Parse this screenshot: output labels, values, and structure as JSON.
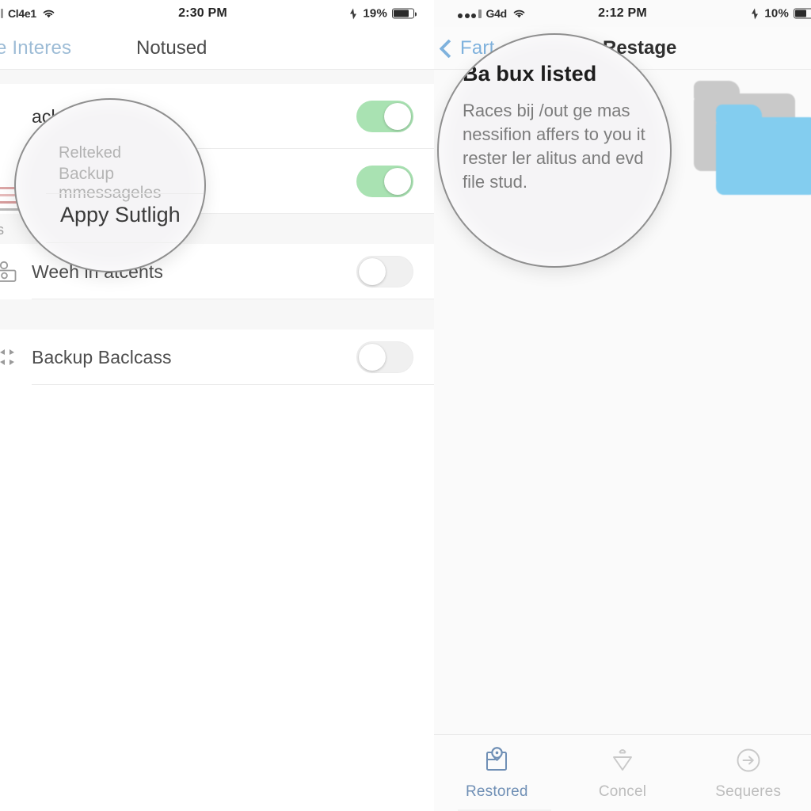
{
  "left_panel": {
    "status_bar": {
      "carrier": "Cl4e1",
      "wifi_icon": "wifi-icon",
      "time": "2:30 PM",
      "location_icon": "location-arrow-icon",
      "battery_percent": "19%",
      "battery_icon": "battery-icon"
    },
    "nav": {
      "back_label": "e Interes",
      "back_icon": "chevron-left-icon",
      "title": "Notused"
    },
    "rows": [
      {
        "icon": "backup-icon",
        "label": "ackus",
        "toggle_state": "on",
        "toggle_color": "#a9e2b2"
      },
      {
        "icon": "highlight-icon",
        "label": "Appy Sutligh",
        "toggle_state": "on",
        "toggle_color": "#a9e2b2"
      },
      {
        "icon": "lock-person-icon",
        "label": "Weeh in atcents",
        "toggle_state": "off",
        "toggle_color": "#f0f0f0"
      },
      {
        "icon": "sync-arrows-icon",
        "label": "Backup Baclcass",
        "toggle_state": "off",
        "toggle_color": "#f0f0f0"
      }
    ],
    "clipped_label": "rs",
    "magnifier": {
      "line1": "Relteked",
      "line2": "Backup mmessageles",
      "highlight_label": "Appy Sutligh"
    }
  },
  "right_panel": {
    "status_bar": {
      "signal_icon": "signal-dots-icon",
      "carrier": "G4d",
      "wifi_icon": "wifi-icon",
      "time": "2:12 PM",
      "location_icon": "location-arrow-icon",
      "battery_percent": "10%",
      "battery_icon": "battery-icon"
    },
    "nav": {
      "back_label": "Fart",
      "back_icon": "chevron-left-icon",
      "title": "Restage"
    },
    "magnifier": {
      "title": "Ba bux listed",
      "body": "Races bij /out ge mas nessifion affers to you it rester ler alitus and evd file stud."
    },
    "folders": {
      "back_folder_color": "#c9c9c9",
      "front_folder_color": "#83cdef"
    },
    "tabs": [
      {
        "label": "Restored",
        "icon": "restore-box-icon",
        "state": "active"
      },
      {
        "label": "Concel",
        "icon": "funnel-icon",
        "state": "inactive"
      },
      {
        "label": "Sequeres",
        "icon": "arrow-right-circle-icon",
        "state": "inactive"
      }
    ]
  }
}
